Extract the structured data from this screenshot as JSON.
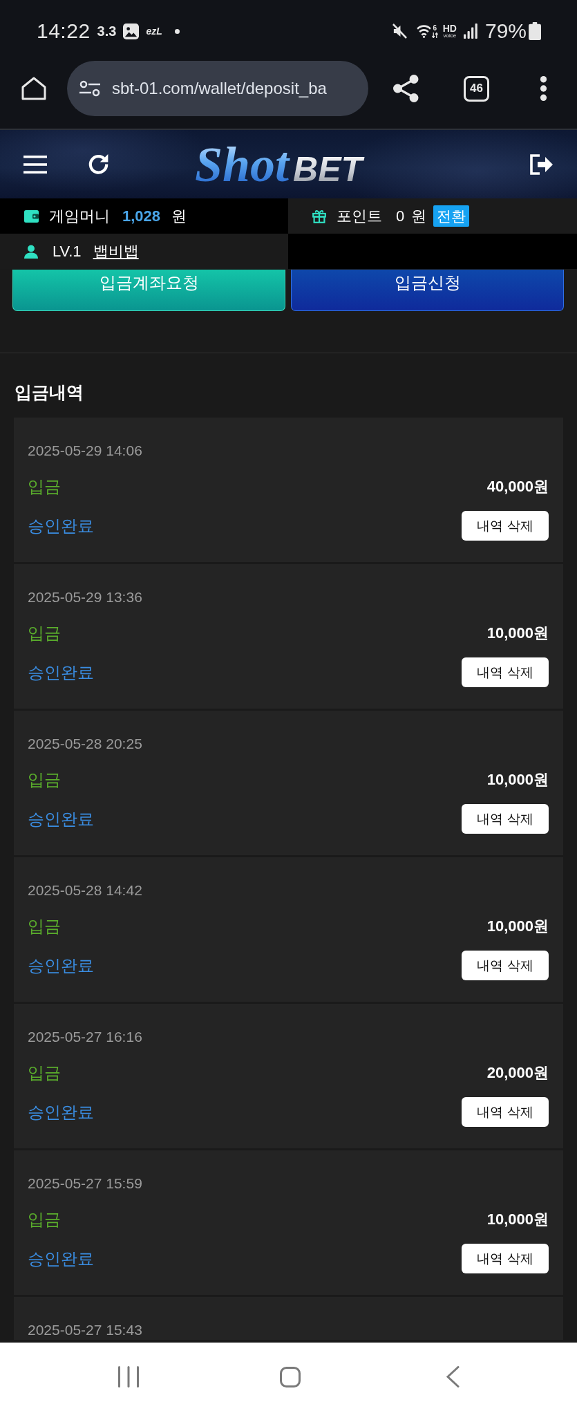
{
  "status_bar": {
    "time": "14:22",
    "notifications": [
      "3.3",
      "ezL"
    ],
    "wifi_band": "6",
    "hd_voice": [
      "HD",
      "voice"
    ],
    "battery": "79%"
  },
  "browser": {
    "url": "sbt-01.com/wallet/deposit_ba",
    "tab_count": "46"
  },
  "header": {
    "logo": [
      "Shot",
      "BET"
    ]
  },
  "wallet": {
    "game_money": {
      "label": "게임머니",
      "amount": "1,028",
      "unit": "원"
    },
    "points": {
      "label": "포인트",
      "amount": "0",
      "unit": "원",
      "button": "전환"
    },
    "level": {
      "label": "LV.1",
      "username": "뱁비뱁"
    }
  },
  "actions": [
    "입금계좌요청",
    "입금신청"
  ],
  "history": {
    "title": "입금내역",
    "records": [
      {
        "date": "2025-05-29 14:06",
        "type": "입금",
        "amount": "40,000원",
        "status": "승인완료",
        "button": "내역 삭제"
      },
      {
        "date": "2025-05-29 13:36",
        "type": "입금",
        "amount": "10,000원",
        "status": "승인완료",
        "button": "내역 삭제"
      },
      {
        "date": "2025-05-28 20:25",
        "type": "입금",
        "amount": "10,000원",
        "status": "승인완료",
        "button": "내역 삭제"
      },
      {
        "date": "2025-05-28 14:42",
        "type": "입금",
        "amount": "10,000원",
        "status": "승인완료",
        "button": "내역 삭제"
      },
      {
        "date": "2025-05-27 16:16",
        "type": "입금",
        "amount": "20,000원",
        "status": "승인완료",
        "button": "내역 삭제"
      },
      {
        "date": "2025-05-27 15:59",
        "type": "입금",
        "amount": "10,000원",
        "status": "승인완료",
        "button": "내역 삭제"
      },
      {
        "date": "2025-05-27 15:43"
      }
    ]
  }
}
